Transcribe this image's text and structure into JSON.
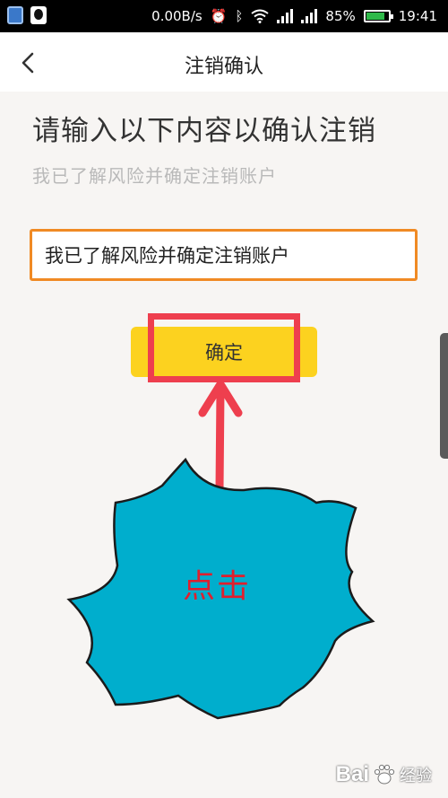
{
  "status_bar": {
    "network_speed": "0.00B/s",
    "battery_percent": "85%",
    "battery_level": 0.85,
    "time": "19:41",
    "icons": [
      "shield-app-icon",
      "qq-app-icon",
      "alarm-icon",
      "bluetooth-icon",
      "wifi-icon",
      "signal-icon",
      "signal-icon",
      "battery-icon"
    ]
  },
  "nav": {
    "title": "注销确认",
    "back_icon": "chevron-left-icon"
  },
  "main": {
    "heading": "请输入以下内容以确认注销",
    "hint": "我已了解风险并确定注销账户",
    "input_value": "我已了解风险并确定注销账户",
    "confirm_label": "确定"
  },
  "annotation": {
    "click_label": "点击",
    "arrow_color": "#ee3f4e",
    "burst_color": "#00aecd",
    "text_color": "#e01f2d"
  },
  "watermark": {
    "brand": "Bai",
    "suffix": "经验"
  },
  "colors": {
    "accent_orange": "#f08a24",
    "button_yellow": "#fcd21f",
    "hint_gray": "#b9b9b9"
  }
}
